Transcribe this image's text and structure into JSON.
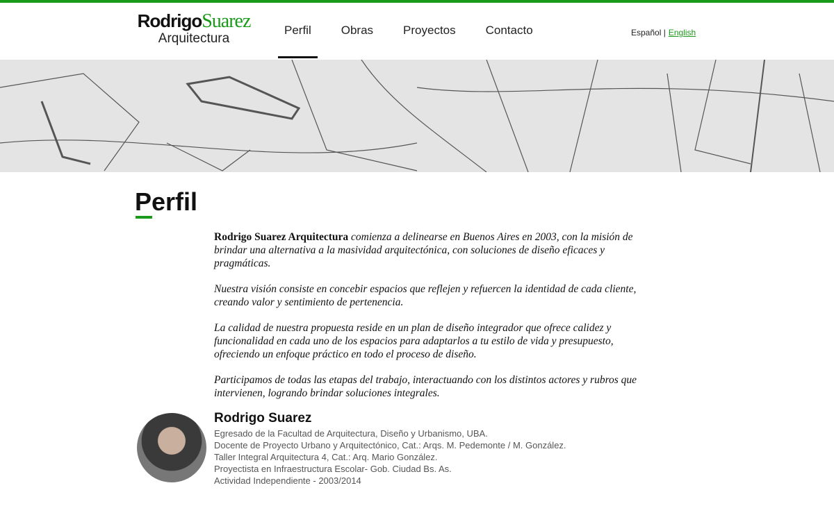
{
  "logo": {
    "first": "Rodrigo",
    "last": "Suarez",
    "sub": "Arquitectura"
  },
  "nav": [
    "Perfil",
    "Obras",
    "Proyectos",
    "Contacto"
  ],
  "lang": {
    "es": "Español",
    "sep": "|",
    "en": "English"
  },
  "page_title": "Perfil",
  "intro": {
    "brand": "Rodrigo Suarez Arquitectura",
    "p1": " comienza a delinearse en Buenos Aires en 2003, con la misión de brindar una alternativa a la masividad arquitectónica, con soluciones de diseño eficaces y pragmáticas.",
    "p2": "Nuestra visión consiste en concebir espacios que reflejen y refuercen la identidad de cada cliente, creando valor y sentimiento de pertenencia.",
    "p3": "La calidad de nuestra propuesta reside en un plan de diseño integrador que ofrece calidez y funcionalidad en cada uno de los espacios para adaptarlos a tu estilo de vida y presupuesto, ofreciendo un enfoque práctico en todo el proceso de diseño.",
    "p4": "Participamos de todas las etapas del trabajo, interactuando con los distintos actores y rubros que intervienen, logrando brindar soluciones integrales."
  },
  "bio": {
    "name": "Rodrigo Suarez",
    "lines": [
      "Egresado de la Facultad de Arquitectura, Diseño y Urbanismo, UBA.",
      "Docente de Proyecto Urbano y Arquitectónico, Cat.: Arqs. M. Pedemonte / M. González.",
      "Taller Integral Arquitectura 4, Cat.: Arq. Mario González.",
      "Proyectista en Infraestructura Escolar- Gob. Ciudad Bs. As.",
      "Actividad Independiente - 2003/2014"
    ]
  }
}
